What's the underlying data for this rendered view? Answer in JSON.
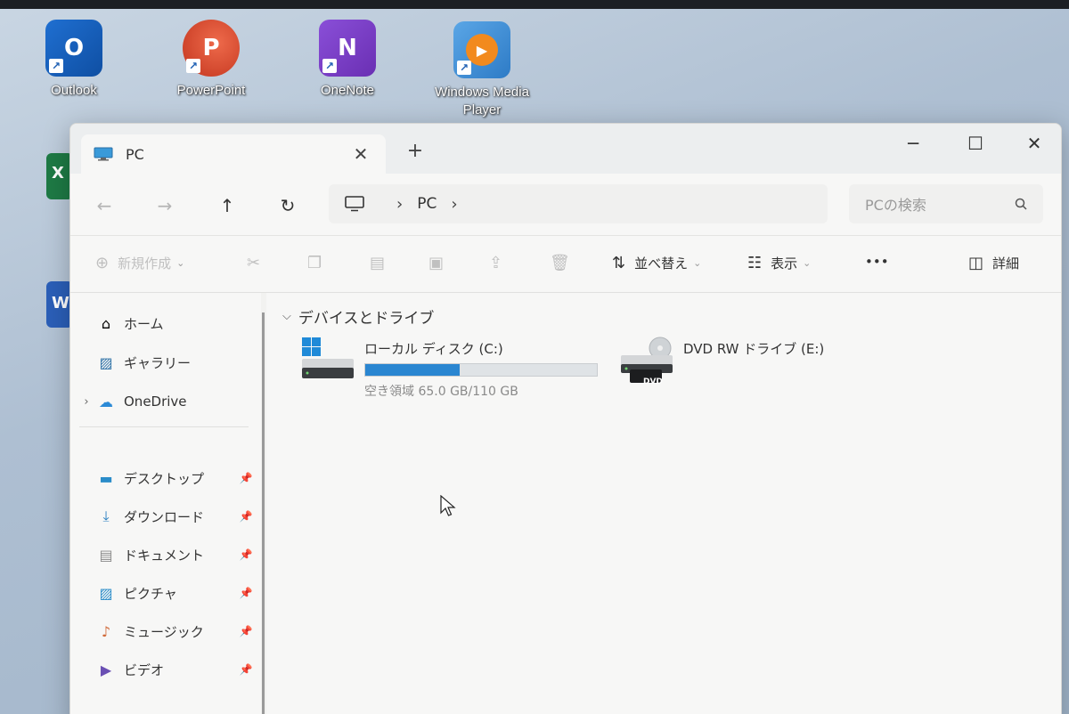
{
  "desktop": {
    "icons": [
      {
        "label": "Outlook",
        "glyph": "O",
        "icon": "outlook-icon"
      },
      {
        "label": "PowerPoint",
        "glyph": "P",
        "icon": "powerpoint-icon"
      },
      {
        "label": "OneNote",
        "glyph": "N",
        "icon": "onenote-icon"
      },
      {
        "label": "Windows Media Player",
        "icon": "windows-media-player-icon"
      }
    ],
    "partial_icons": [
      {
        "glyph": "X",
        "icon": "excel-icon"
      },
      {
        "glyph": "W",
        "icon": "word-icon"
      }
    ]
  },
  "window": {
    "tab_title": "PC",
    "new_tab": "+",
    "controls": {
      "minimize": "─",
      "maximize": "☐",
      "close": "✕"
    },
    "nav": {
      "back": "←",
      "forward": "→",
      "up": "↑",
      "refresh": "↻"
    },
    "address": {
      "crumbs": [
        "PC"
      ],
      "separator": "›"
    },
    "search": {
      "placeholder": "PCの検索"
    },
    "toolbar": {
      "new": "新規作成",
      "sort": "並べ替え",
      "view": "表示",
      "more": "•••",
      "details": "詳細"
    },
    "sidebar": {
      "items": [
        {
          "label": "ホーム",
          "icon": "home-icon",
          "expandable": false
        },
        {
          "label": "ギャラリー",
          "icon": "gallery-icon",
          "expandable": false
        },
        {
          "label": "OneDrive",
          "icon": "onedrive-icon",
          "expandable": true
        }
      ],
      "pinned": [
        {
          "label": "デスクトップ",
          "icon": "desktop-folder-icon"
        },
        {
          "label": "ダウンロード",
          "icon": "download-icon"
        },
        {
          "label": "ドキュメント",
          "icon": "documents-icon"
        },
        {
          "label": "ピクチャ",
          "icon": "pictures-icon"
        },
        {
          "label": "ミュージック",
          "icon": "music-icon"
        },
        {
          "label": "ビデオ",
          "icon": "video-icon"
        }
      ]
    },
    "content": {
      "group_title": "デバイスとドライブ",
      "drives": [
        {
          "name": "ローカル ディスク (C:)",
          "free_text": "空き領域 65.0 GB/110 GB",
          "used_fraction": 0.409
        },
        {
          "name": "DVD RW ドライブ (E:)",
          "badge": "DVD"
        }
      ]
    }
  },
  "colors": {
    "accent": "#2a86d1",
    "window_bg": "#f7f7f6",
    "text": "#333333"
  }
}
